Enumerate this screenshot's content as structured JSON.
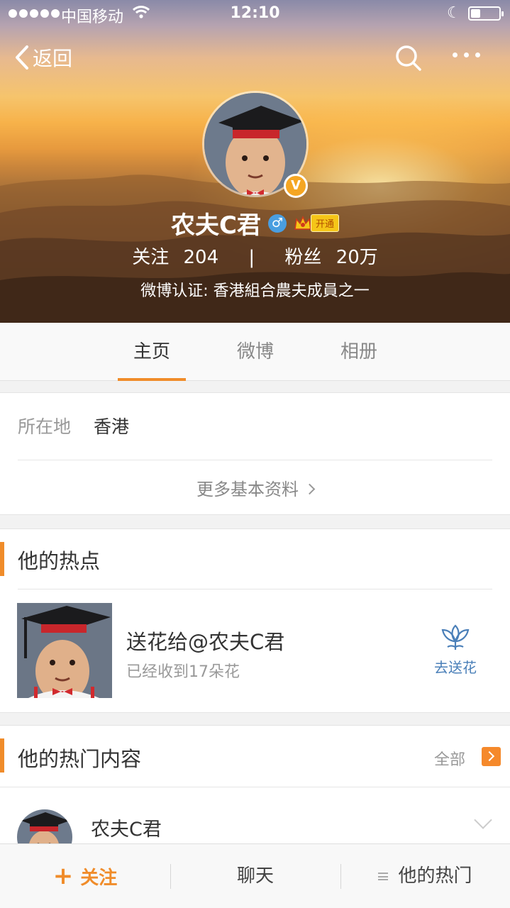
{
  "status_bar": {
    "carrier": "中国移动",
    "time": "12:10",
    "battery_level": 0.35,
    "icons": [
      "signal-dots-icon",
      "wifi-icon",
      "moon-icon",
      "battery-icon"
    ]
  },
  "nav": {
    "back_label": "返回",
    "icons": [
      "back-chevron-icon",
      "search-icon",
      "more-dots-icon"
    ]
  },
  "profile": {
    "name": "农夫C君",
    "verified_badge": "V",
    "gender_symbol": "♂",
    "vip_label": "开通",
    "following_label": "关注",
    "following_count": "204",
    "separator": "|",
    "followers_label": "粉丝",
    "followers_count": "20万",
    "verification": "微博认证: 香港組合農夫成員之一"
  },
  "tabs": [
    {
      "label": "主页",
      "active": true
    },
    {
      "label": "微博",
      "active": false
    },
    {
      "label": "相册",
      "active": false
    }
  ],
  "info": {
    "location_key": "所在地",
    "location_value": "香港",
    "more_label": "更多基本资料"
  },
  "hot": {
    "title": "他的热点",
    "flower_title": "送花给@农夫C君",
    "flower_sub": "已经收到17朵花",
    "send_label": "去送花"
  },
  "content": {
    "title": "他的热门内容",
    "all_label": "全部",
    "post_author": "农夫C君"
  },
  "bottom_bar": {
    "follow_plus": "+",
    "follow": "关注",
    "chat": "聊天",
    "hot": "他的热门"
  },
  "colors": {
    "accent": "#f08c2a",
    "link_blue": "#4a7fb8",
    "verified_gold": "#f5a623"
  }
}
